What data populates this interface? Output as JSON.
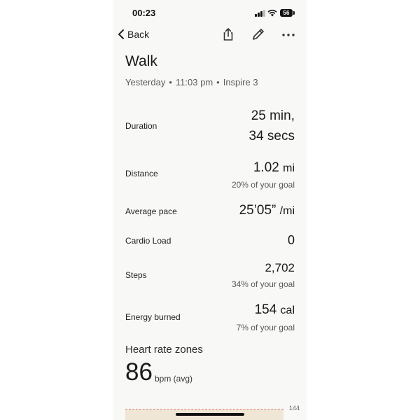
{
  "status_bar": {
    "time": "00:23",
    "battery": "56"
  },
  "nav": {
    "back_label": "Back"
  },
  "activity": {
    "title": "Walk",
    "subtitle_day": "Yesterday",
    "subtitle_time": "11:03 pm",
    "subtitle_device": "Inspire 3",
    "dot": "•"
  },
  "stats": {
    "duration": {
      "label": "Duration",
      "value_line1": "25 min,",
      "value_line2": "34 secs"
    },
    "distance": {
      "label": "Distance",
      "value": "1.02",
      "unit": "mi",
      "sub": "20% of your goal"
    },
    "pace": {
      "label": "Average pace",
      "value": "25’05”",
      "unit": "/mi"
    },
    "cardio": {
      "label": "Cardio Load",
      "value": "0"
    },
    "steps": {
      "label": "Steps",
      "value": "2,702",
      "sub": "34% of your goal"
    },
    "energy": {
      "label": "Energy burned",
      "value": "154",
      "unit": "cal",
      "sub": "7% of your goal"
    }
  },
  "heart_rate": {
    "title": "Heart rate zones",
    "avg": "86",
    "unit": "bpm (avg)",
    "chart_max_tick": "144"
  }
}
